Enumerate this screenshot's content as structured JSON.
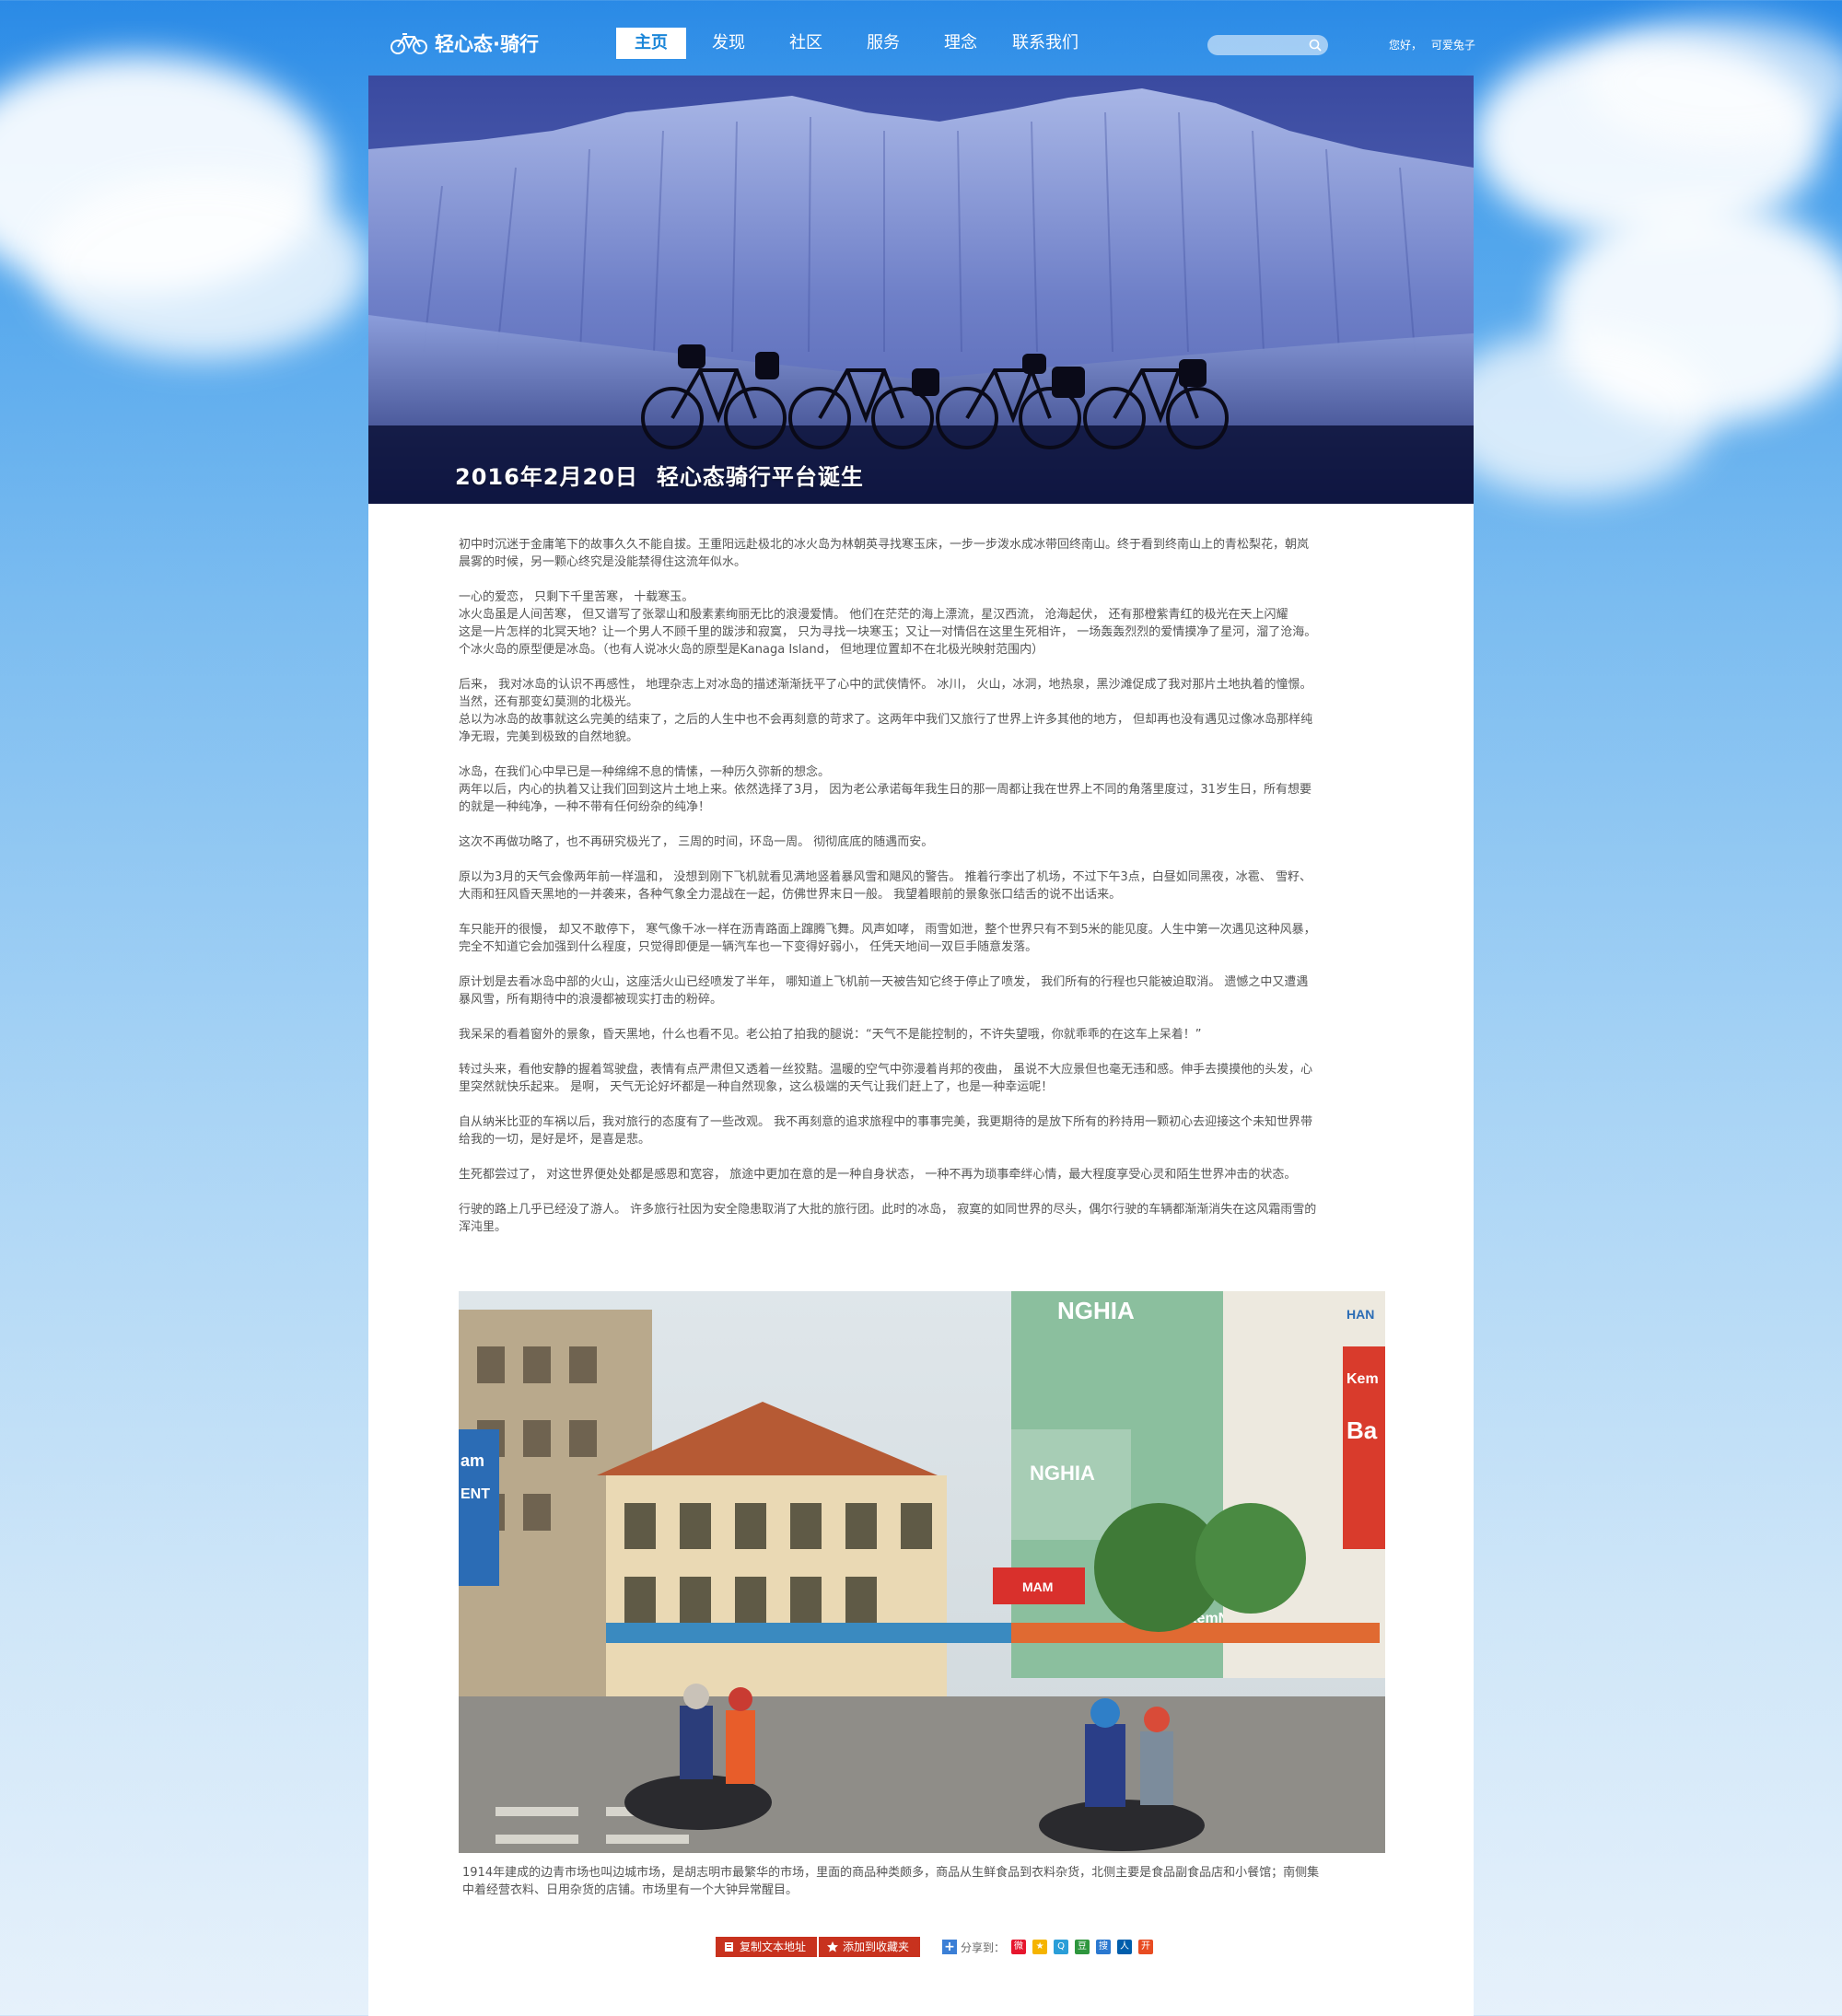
{
  "logo": {
    "text": "轻心态·骑行"
  },
  "nav": [
    {
      "label": "主页",
      "active": true
    },
    {
      "label": "发现"
    },
    {
      "label": "社区"
    },
    {
      "label": "服务"
    },
    {
      "label": "理念"
    },
    {
      "label": "联系我们"
    }
  ],
  "search": {
    "placeholder": ""
  },
  "user": {
    "greeting": "您好，",
    "name": "可爱兔子"
  },
  "hero": {
    "date": "2016年2月20日",
    "title": "轻心态骑行平台诞生"
  },
  "article": {
    "paragraphs": [
      [
        "初中时沉迷于金庸笔下的故事久久不能自拔。王重阳远赴极北的冰火岛为林朝英寻找寒玉床，一步一步泼水成冰带回终南山。终于看到终南山上的青松梨花，朝岚",
        "晨雾的时候，另一颗心终究是没能禁得住这流年似水。"
      ],
      [
        "一心的爱恋， 只剩下千里苦寒， 十载寒玉。",
        "冰火岛虽是人间苦寒， 但又谱写了张翠山和殷素素绚丽无比的浪漫爱情。 他们在茫茫的海上漂流，星汉西流， 沧海起伏， 还有那橙紫青红的极光在天上闪耀",
        "这是一片怎样的北冥天地？让一个男人不顾千里的跋涉和寂寞， 只为寻找一块寒玉；又让一对情侣在这里生死相许， 一场轰轰烈烈的爱情摸净了星河，溜了沧海。",
        "个冰火岛的原型便是冰岛。（也有人说冰火岛的原型是Kanaga Island， 但地理位置却不在北极光映射范围内）"
      ],
      [
        "后来， 我对冰岛的认识不再感性， 地理杂志上对冰岛的描述渐渐抚平了心中的武侠情怀。 冰川， 火山，冰洞，地热泉，黑沙滩促成了我对那片土地执着的憧憬。",
        "当然，还有那变幻莫测的北极光。",
        "总以为冰岛的故事就这么完美的结束了，之后的人生中也不会再刻意的苛求了。这两年中我们又旅行了世界上许多其他的地方， 但却再也没有遇见过像冰岛那样纯",
        "净无瑕，完美到极致的自然地貌。"
      ],
      [
        "冰岛，在我们心中早已是一种绵绵不息的情愫，一种历久弥新的想念。",
        "两年以后，内心的执着又让我们回到这片土地上来。依然选择了3月， 因为老公承诺每年我生日的那一周都让我在世界上不同的角落里度过，31岁生日，所有想要",
        "的就是一种纯净，一种不带有任何纷杂的纯净！"
      ],
      [
        "这次不再做功略了，也不再研究极光了， 三周的时间，环岛一周。 彻彻底底的随遇而安。"
      ],
      [
        "原以为3月的天气会像两年前一样温和， 没想到刚下飞机就看见满地竖着暴风雪和飓风的警告。 推着行李出了机场，不过下午3点，白昼如同黑夜，冰雹、 雪籽、",
        "大雨和狂风昏天黑地的一并袭来，各种气象全力混战在一起，仿佛世界末日一般。 我望着眼前的景象张口结舌的说不出话来。"
      ],
      [
        "车只能开的很慢， 却又不敢停下， 寒气像千冰一样在沥青路面上蹿腾飞舞。风声如哮， 雨雪如泄，整个世界只有不到5米的能见度。人生中第一次遇见这种风暴，",
        "完全不知道它会加强到什么程度，只觉得即便是一辆汽车也一下变得好弱小， 任凭天地间一双巨手随意发落。"
      ],
      [
        "原计划是去看冰岛中部的火山，这座活火山已经喷发了半年， 哪知道上飞机前一天被告知它终于停止了喷发， 我们所有的行程也只能被迫取消。 遗憾之中又遭遇",
        "暴风雪，所有期待中的浪漫都被现实打击的粉碎。"
      ],
      [
        "我呆呆的看着窗外的景象，昏天黑地，什么也看不见。老公拍了拍我的腿说：“天气不是能控制的，不许失望哦，你就乖乖的在这车上呆着！”"
      ],
      [
        "转过头来，看他安静的握着驾驶盘，表情有点严肃但又透着一丝狡黠。温暖的空气中弥漫着肖邦的夜曲， 虽说不大应景但也毫无违和感。伸手去摸摸他的头发，心",
        "里突然就快乐起来。 是啊， 天气无论好坏都是一种自然现象，这么极端的天气让我们赶上了，也是一种幸运呢！"
      ],
      [
        "自从纳米比亚的车祸以后，我对旅行的态度有了一些改观。 我不再刻意的追求旅程中的事事完美，我更期待的是放下所有的矜持用一颗初心去迎接这个未知世界带",
        "给我的一切，是好是坏，是喜是悲。"
      ],
      [
        "生死都尝过了， 对这世界便处处都是感恩和宽容， 旅途中更加在意的是一种自身状态， 一种不再为琐事牵绊心情，最大程度享受心灵和陌生世界冲击的状态。"
      ],
      [
        "行驶的路上几乎已经没了游人。 许多旅行社因为安全隐患取消了大批的旅行团。此时的冰岛， 寂寞的如同世界的尽头，偶尔行驶的车辆都渐渐消失在这风霜雨雪的",
        "浑沌里。"
      ]
    ]
  },
  "photo": {
    "signs": {
      "nghia": "NGHIA",
      "nghia2": "KemNGHIA",
      "mam": "MAM",
      "cream": "Kem",
      "ba": "Ba",
      "ent": "ENT",
      "ham": "HAN"
    },
    "caption_lines": [
      "1914年建成的边青市场也叫边城市场，是胡志明市最繁华的市场，里面的商品种类颇多，商品从生鲜食品到衣料杂货，北侧主要是食品副食品店和小餐馆；南侧集",
      "中着经营衣料、日用杂货的店铺。市场里有一个大钟异常醒目。"
    ]
  },
  "share": {
    "copy_label": "复制文本地址",
    "fav_label": "添加到收藏夹",
    "share_label": "分享到：",
    "icons": [
      {
        "name": "weibo-share-icon",
        "color": "#e6162d",
        "glyph": "微"
      },
      {
        "name": "qzone-share-icon",
        "color": "#f5b400",
        "glyph": "★"
      },
      {
        "name": "tencent-weibo-share-icon",
        "color": "#2a9ed8",
        "glyph": "Q"
      },
      {
        "name": "douban-share-icon",
        "color": "#2e963d",
        "glyph": "豆"
      },
      {
        "name": "sohu-share-icon",
        "color": "#2a78d0",
        "glyph": "搜"
      },
      {
        "name": "renren-share-icon",
        "color": "#005eac",
        "glyph": "人"
      },
      {
        "name": "kaixin-share-icon",
        "color": "#e84c22",
        "glyph": "开"
      }
    ]
  }
}
